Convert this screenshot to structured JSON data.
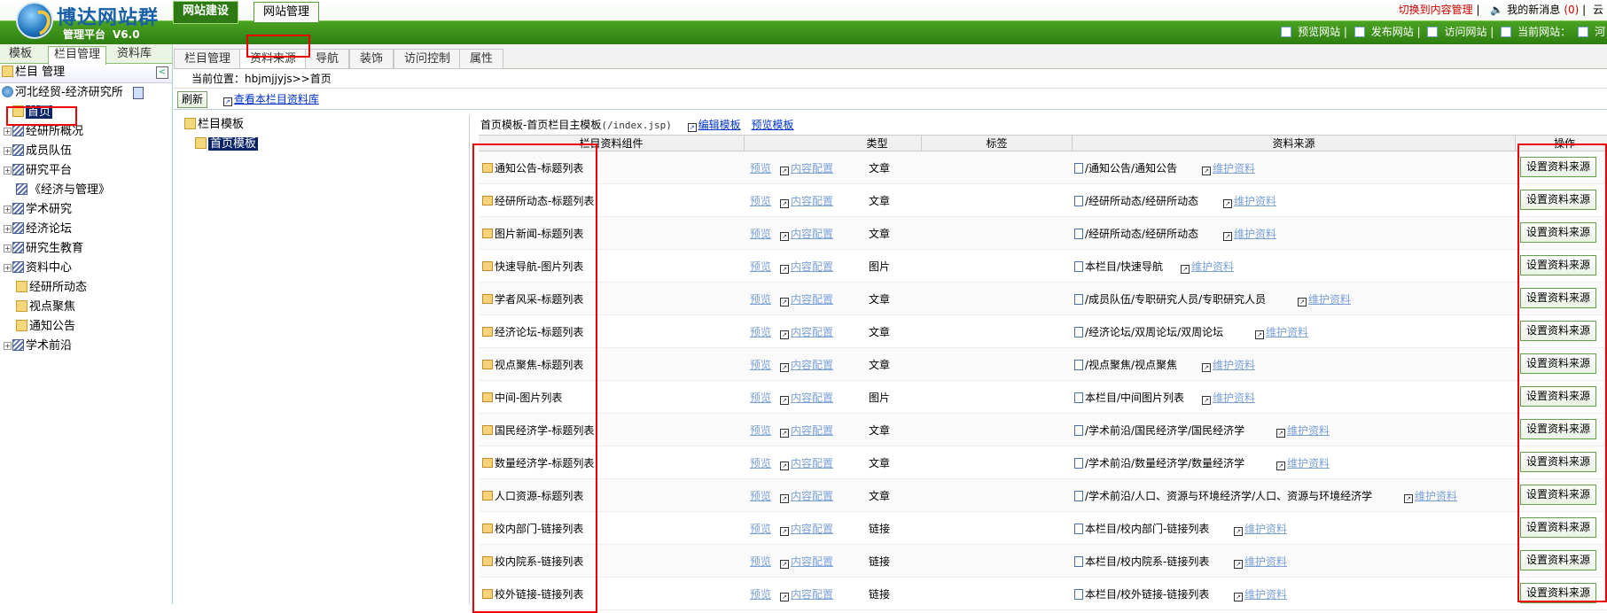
{
  "app": {
    "brand": "博达网站群",
    "platform": "管理平台",
    "version": "V6.0"
  },
  "maintabs": [
    "网站建设",
    "网站管理"
  ],
  "toplinks": {
    "switch": "切换到内容管理",
    "messages": "我的新消息",
    "msg_count": "(0)",
    "cloud": "云"
  },
  "actions": [
    "预览网站",
    "发布网站",
    "访问网站",
    "当前网站：",
    "河"
  ],
  "left": {
    "tabs": [
      "模板",
      "栏目管理",
      "资料库"
    ],
    "heading": "栏目 管理",
    "tree": [
      "河北经贸-经济研究所",
      "首页",
      "经研所概况",
      "成员队伍",
      "研究平台",
      "《经济与管理》",
      "学术研究",
      "经济论坛",
      "研究生教育",
      "资料中心",
      "经研所动态",
      "视点聚焦",
      "通知公告",
      "学术前沿"
    ]
  },
  "subtabs": [
    "栏目管理",
    "资料来源",
    "导航",
    "装饰",
    "访问控制",
    "属性"
  ],
  "crumb": "当前位置：hbjmjjyjs>>首页",
  "toolbar": {
    "refresh": "刷新",
    "view_lib": "查看本栏目资料库"
  },
  "tmpl": {
    "root": "栏目模板",
    "child": "首页模板"
  },
  "template_info": {
    "name": "首页模板-首页栏目主模板",
    "path": "(/index.jsp)",
    "edit": "编辑模板",
    "preview": "预览模板"
  },
  "columns": [
    "栏目资料组件",
    "",
    "类型",
    "标签",
    "资料来源",
    "操作"
  ],
  "preview_label": "预览",
  "config_label": "内容配置",
  "maintain_label": "维护资料",
  "action_label": "设置资料来源",
  "rows": [
    {
      "name": "通知公告-标题列表",
      "type": "文章",
      "source": "/通知公告/通知公告"
    },
    {
      "name": "经研所动态-标题列表",
      "type": "文章",
      "source": "/经研所动态/经研所动态"
    },
    {
      "name": "图片新闻-标题列表",
      "type": "文章",
      "source": "/经研所动态/经研所动态"
    },
    {
      "name": "快速导航-图片列表",
      "type": "图片",
      "source": "本栏目/快速导航"
    },
    {
      "name": "学者风采-标题列表",
      "type": "文章",
      "source": "/成员队伍/专职研究人员/专职研究人员"
    },
    {
      "name": "经济论坛-标题列表",
      "type": "文章",
      "source": "/经济论坛/双周论坛/双周论坛"
    },
    {
      "name": "视点聚焦-标题列表",
      "type": "文章",
      "source": "/视点聚焦/视点聚焦"
    },
    {
      "name": "中间-图片列表",
      "type": "图片",
      "source": "本栏目/中间图片列表"
    },
    {
      "name": "国民经济学-标题列表",
      "type": "文章",
      "source": "/学术前沿/国民经济学/国民经济学"
    },
    {
      "name": "数量经济学-标题列表",
      "type": "文章",
      "source": "/学术前沿/数量经济学/数量经济学"
    },
    {
      "name": "人口资源-标题列表",
      "type": "文章",
      "source": "/学术前沿/人口、资源与环境经济学/人口、资源与环境经济学"
    },
    {
      "name": "校内部门-链接列表",
      "type": "链接",
      "source": "本栏目/校内部门-链接列表"
    },
    {
      "name": "校内院系-链接列表",
      "type": "链接",
      "source": "本栏目/校内院系-链接列表"
    },
    {
      "name": "校外链接-链接列表",
      "type": "链接",
      "source": "本栏目/校外链接-链接列表"
    }
  ]
}
